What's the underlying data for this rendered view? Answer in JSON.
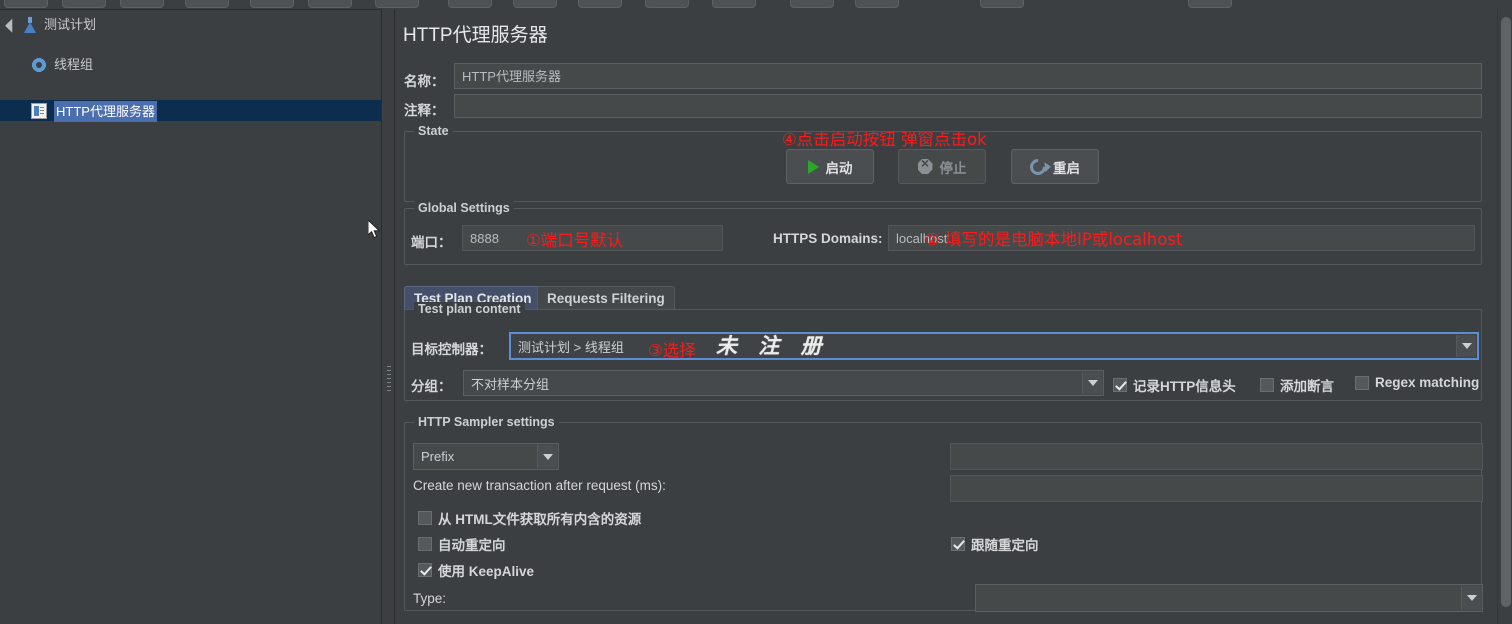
{
  "window": {
    "title": "HTTP代理服务器"
  },
  "toolbar": {
    "button_count": 16
  },
  "tree": {
    "items": [
      {
        "label": "测试计划",
        "icon": "flask-icon",
        "depth": 0,
        "expanded": true,
        "selected": false
      },
      {
        "label": "线程组",
        "icon": "gear-icon",
        "depth": 1,
        "expanded": false,
        "selected": false
      },
      {
        "label": "HTTP代理服务器",
        "icon": "proxy-icon",
        "depth": 1,
        "expanded": false,
        "selected": true
      }
    ]
  },
  "header": {
    "title": "HTTP代理服务器",
    "name_label": "名称：",
    "name_value": "HTTP代理服务器",
    "comment_label": "注释：",
    "comment_value": ""
  },
  "state": {
    "group_title": "State",
    "start_label": "启动",
    "stop_label": "停止",
    "restart_label": "重启",
    "stop_disabled": true
  },
  "global_settings": {
    "group_title": "Global Settings",
    "port_label": "端口：",
    "port_value": "8888",
    "https_domains_label": "HTTPS Domains:",
    "https_domains_value": "localhost"
  },
  "tabs": [
    {
      "label": "Test Plan Creation",
      "active": true
    },
    {
      "label": "Requests Filtering",
      "active": false
    }
  ],
  "test_plan_content": {
    "group_title": "Test plan content",
    "target_controller_label": "目标控制器：",
    "target_controller_value": "测试计划 > 线程组",
    "grouping_label": "分组：",
    "grouping_value": "不对样本分组",
    "checkboxes": [
      {
        "label": "记录HTTP信息头",
        "checked": true
      },
      {
        "label": "添加断言",
        "checked": false
      },
      {
        "label": "Regex matching",
        "checked": false
      }
    ]
  },
  "http_sampler_settings": {
    "group_title": "HTTP Sampler settings",
    "prefix_value": "Prefix",
    "prefix_field_value": "",
    "transaction_label": "Create new transaction after request (ms):",
    "transaction_value": "",
    "checkboxes": [
      {
        "label": "从 HTML文件获取所有内含的资源",
        "checked": false
      },
      {
        "label": "自动重定向",
        "checked": false
      },
      {
        "label": "使用 KeepAlive",
        "checked": true
      }
    ],
    "follow_redirect": {
      "label": "跟随重定向",
      "checked": true
    },
    "type_label": "Type:",
    "type_value": ""
  },
  "annotations": [
    {
      "id": "anno-start",
      "text": "④点击启动按钮 弹窗点击ok",
      "color": "#ff1a1a"
    },
    {
      "id": "anno-port",
      "text": "①端口号默认",
      "color": "#ff1a1a"
    },
    {
      "id": "anno-https",
      "text": "② 填写的是电脑本地IP或localhost",
      "color": "#ff1a1a"
    },
    {
      "id": "anno-select",
      "text": "③选择",
      "color": "#ff1a1a"
    }
  ],
  "watermark": {
    "text": "未 注 册"
  },
  "colors": {
    "background": "#3c3f41",
    "panel": "#45494a",
    "selection": "#0d2d4e",
    "highlight": "#4b6eaf",
    "accent_blue": "#5c8ed6",
    "annotation_red": "#ff1a1a",
    "start_green": "#27a827"
  }
}
